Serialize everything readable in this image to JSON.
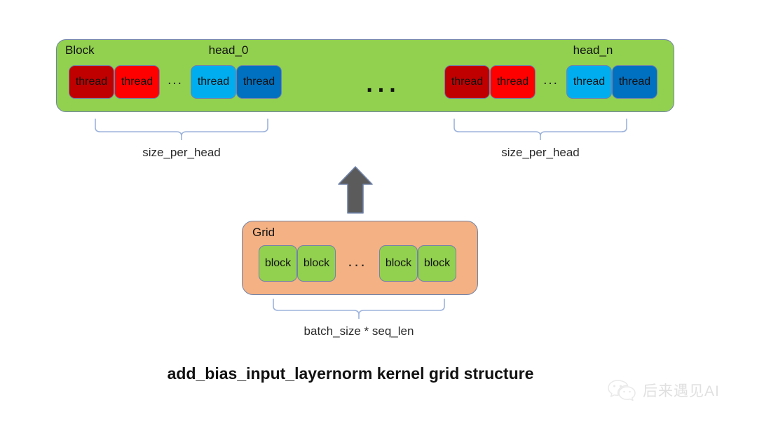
{
  "diagram": {
    "caption": "add_bias_input_layernorm kernel grid structure",
    "block": {
      "title": "Block",
      "heads": [
        {
          "label": "head_0",
          "threads": [
            "thread",
            "thread",
            "thread",
            "thread"
          ],
          "inner_ellipsis": "...",
          "brace_label": "size_per_head"
        },
        {
          "label": "head_n",
          "threads": [
            "thread",
            "thread",
            "thread",
            "thread"
          ],
          "inner_ellipsis": "...",
          "brace_label": "size_per_head"
        }
      ],
      "mid_ellipsis": "..."
    },
    "grid": {
      "title": "Grid",
      "blocks": [
        "block",
        "block",
        "block",
        "block"
      ],
      "ellipsis": "...",
      "brace_label": "batch_size * seq_len"
    },
    "colors": {
      "block_fill": "#92D050",
      "grid_fill": "#F4B183",
      "thread_dark_red": "#C00000",
      "thread_bright_red": "#FF0000",
      "thread_light_blue": "#00AEEF",
      "thread_dark_blue": "#0070C0",
      "shape_border": "#7083A8",
      "arrow_fill": "#5B5B5B",
      "brace_stroke": "#9DB3DC"
    }
  },
  "watermark": {
    "text": "后来遇见AI",
    "icon": "wechat-icon"
  }
}
